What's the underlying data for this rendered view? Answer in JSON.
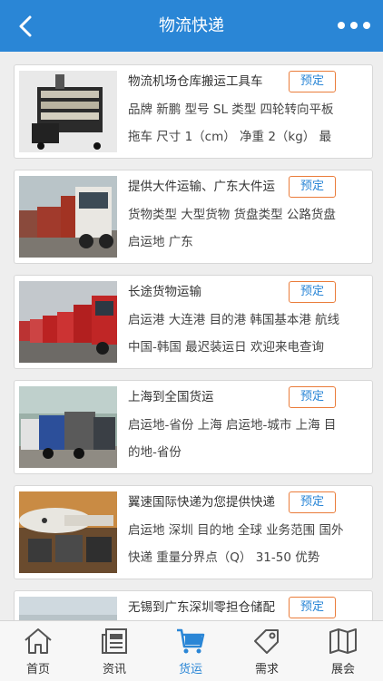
{
  "header": {
    "title": "物流快递",
    "back_icon": "back-arrow-icon",
    "more_icon": "more-dots-icon",
    "bg_color": "#2a86d6"
  },
  "products": [
    {
      "name": "物流机场仓库搬运工具车",
      "desc": "品牌 新鹏 型号 SL 类型 四轮转向平板拖车 尺寸 1（cm） 净重 2（kg） 最",
      "button": "预定",
      "image": "tool-cart-photo"
    },
    {
      "name": "提供大件运输、广东大件运",
      "desc": "货物类型 大型货物 货盘类型 公路货盘 启运地 广东",
      "button": "预定",
      "image": "trucks-photo"
    },
    {
      "name": "长途货物运输",
      "desc": "启运港 大连港 目的港 韩国基本港 航线 中国-韩国 最迟装运日 欢迎来电查询",
      "button": "预定",
      "image": "truck-fleet-photo"
    },
    {
      "name": "上海到全国货运",
      "desc": "启运地-省份 上海 启运地-城市 上海 目的地-省份",
      "button": "预定",
      "image": "cargo-trucks-photo"
    },
    {
      "name": "翼速国际快递为您提供快递",
      "desc": "启运地 深圳 目的地 全球 业务范围 国外快递 重量分界点（Q） 31-50 优势",
      "button": "预定",
      "image": "airport-cargo-photo"
    },
    {
      "name": "无锡到广东深圳零担仓储配",
      "desc": "",
      "button": "预定",
      "image": "warehouse-photo"
    }
  ],
  "tabs": [
    {
      "label": "首页",
      "icon": "home-icon",
      "active": false
    },
    {
      "label": "资讯",
      "icon": "news-icon",
      "active": false
    },
    {
      "label": "货运",
      "icon": "cart-icon",
      "active": true
    },
    {
      "label": "需求",
      "icon": "tag-icon",
      "active": false
    },
    {
      "label": "展会",
      "icon": "map-icon",
      "active": false
    }
  ],
  "colors": {
    "accent": "#2a86d6",
    "button_border": "#ea7c3a"
  }
}
